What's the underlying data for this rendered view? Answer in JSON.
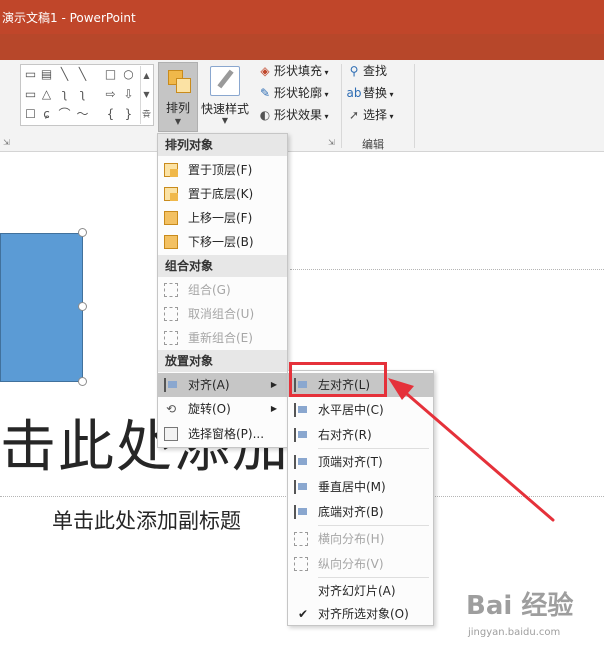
{
  "window": {
    "title": "演示文稿1 - PowerPoint"
  },
  "ribbon": {
    "shapes": [
      "▭",
      "▤",
      "╲",
      "╲",
      "□",
      "○",
      "▭",
      "△",
      "ʅ",
      "ʅ",
      "⇨",
      "⇩",
      "☐",
      "ɕ",
      "⌒",
      "〜",
      "{",
      "}",
      "☆"
    ],
    "arrange": {
      "label": "排列",
      "icon": "arrange-icon"
    },
    "quick_styles": {
      "label": "快速样式",
      "icon": "quick-styles-icon"
    },
    "shape_fill": {
      "label": "形状填充",
      "icon": "paint-bucket-icon"
    },
    "shape_outline": {
      "label": "形状轮廓",
      "icon": "pen-icon"
    },
    "shape_effects": {
      "label": "形状效果",
      "icon": "shape-effects-icon"
    },
    "find": {
      "label": "查找",
      "icon": "search-icon"
    },
    "replace": {
      "label": "替换",
      "icon": "replace-icon"
    },
    "select": {
      "label": "选择",
      "icon": "cursor-icon"
    },
    "edit_group": {
      "label": "编辑"
    }
  },
  "arrange_menu": {
    "order_header": "排列对象",
    "bring_front": "置于顶层(F)",
    "send_back": "置于底层(K)",
    "bring_forward": "上移一层(F)",
    "send_backward": "下移一层(B)",
    "group_header": "组合对象",
    "group": "组合(G)",
    "ungroup": "取消组合(U)",
    "regroup": "重新组合(E)",
    "position_header": "放置对象",
    "align": "对齐(A)",
    "rotate": "旋转(O)",
    "selection_pane": "选择窗格(P)..."
  },
  "align_menu": {
    "left": "左对齐(L)",
    "center": "水平居中(C)",
    "right": "右对齐(R)",
    "top": "顶端对齐(T)",
    "middle": "垂直居中(M)",
    "bottom": "底端对齐(B)",
    "distribute_h": "横向分布(H)",
    "distribute_v": "纵向分布(V)",
    "to_slide": "对齐幻灯片(A)",
    "to_selected": "对齐所选对象(O)"
  },
  "slide": {
    "title_placeholder": "击此处添加标题",
    "subtitle_placeholder": "单击此处添加副标题"
  },
  "watermark": {
    "line1": "Bai 经验",
    "line2": "jingyan.baidu.com"
  },
  "colors": {
    "titlebar": "#c0462a",
    "highlight_box": "#e5313a",
    "shape_fill": "#5b9bd5"
  }
}
